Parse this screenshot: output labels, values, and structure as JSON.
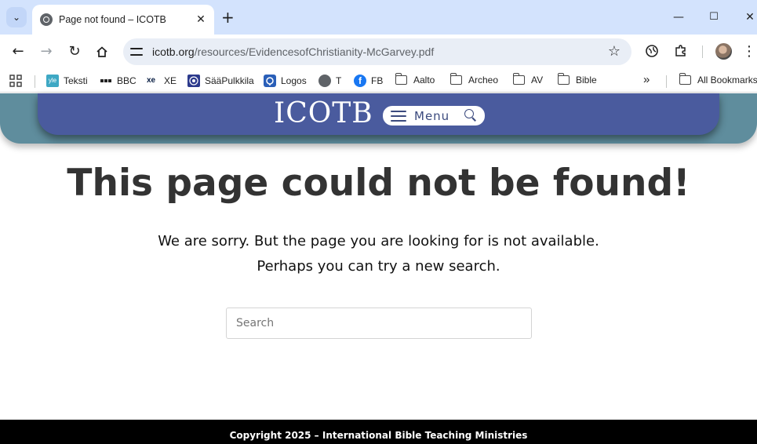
{
  "browser": {
    "tab_title": "Page not found – ICOTB",
    "url_host": "icotb.org",
    "url_path": "/resources/EvidencesofChristianity-McGarvey.pdf",
    "window_controls": {
      "minimize": "—",
      "maximize": "☐",
      "close": "✕"
    }
  },
  "bookmarks": {
    "items": [
      {
        "label": "Teksti",
        "icon": "yle-icon"
      },
      {
        "label": "BBC",
        "icon": "bbc-icon"
      },
      {
        "label": "XE",
        "icon": "xe-icon"
      },
      {
        "label": "SääPulkkila",
        "icon": "weather-icon"
      },
      {
        "label": "Logos",
        "icon": "logos-icon"
      },
      {
        "label": "T",
        "icon": "globe-icon"
      },
      {
        "label": "FB",
        "icon": "facebook-icon"
      },
      {
        "label": "Aalto",
        "icon": "folder-icon"
      },
      {
        "label": "Archeo",
        "icon": "folder-icon"
      },
      {
        "label": "AV",
        "icon": "folder-icon"
      },
      {
        "label": "Bible",
        "icon": "folder-icon"
      }
    ],
    "overflow": "»",
    "all_bookmarks": "All Bookmarks"
  },
  "site": {
    "logo": "ICOTB",
    "menu_label": "Menu",
    "colors": {
      "header_bg": "#4a5b9e",
      "header_outer": "#5f8d9d",
      "footer_bg": "#000000"
    }
  },
  "main": {
    "heading": "This page could not be found!",
    "sorry": "We are sorry. But the page you are looking for is not available.",
    "perhaps": "Perhaps you can try a new search.",
    "search_placeholder": "Search"
  },
  "footer": {
    "copyright": "Copyright 2025 – International Bible Teaching Ministries"
  }
}
